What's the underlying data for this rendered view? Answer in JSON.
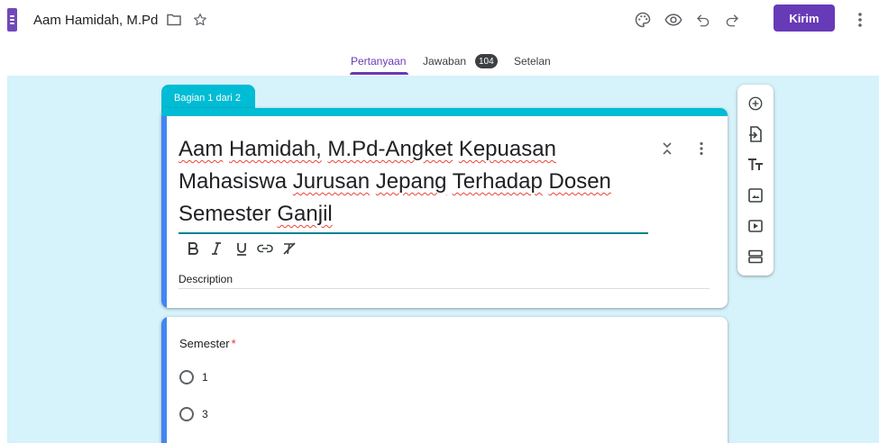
{
  "app": {
    "doc_title": "Aam Hamidah, M.Pd",
    "accent": "#673ab7"
  },
  "header": {
    "icons": [
      "folder-icon",
      "star-icon",
      "palette-icon",
      "preview-eye-icon",
      "undo-icon",
      "redo-icon",
      "more-vert-icon"
    ],
    "send_label": "Kirim"
  },
  "tabs": {
    "questions": "Pertanyaan",
    "responses": "Jawaban",
    "response_count": "104",
    "settings": "Setelan"
  },
  "section": {
    "label": "Bagian 1 dari 2",
    "color": "#00bcd4"
  },
  "form": {
    "title_words": [
      "Aam",
      "Hamidah,",
      "M.Pd-Angket",
      "Kepuasan",
      "Mahasiswa",
      "Jurusan",
      "Jepang",
      "Terhadap",
      "Dosen",
      "Semester",
      "Ganjil"
    ],
    "description_placeholder": "Description",
    "format_tools": [
      "bold-icon",
      "italic-icon",
      "underline-icon",
      "link-icon",
      "clear-format-icon"
    ]
  },
  "question": {
    "title": "Semester",
    "required_mark": "*",
    "options": [
      "1",
      "3"
    ]
  },
  "side_toolbar": [
    "add-question-icon",
    "import-questions-icon",
    "add-title-icon",
    "add-image-icon",
    "add-video-icon",
    "add-section-icon"
  ]
}
